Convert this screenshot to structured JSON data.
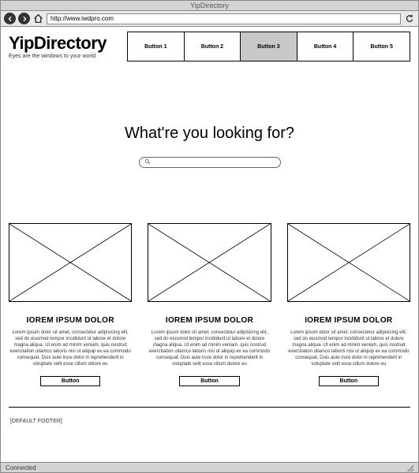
{
  "window": {
    "title": "YipDirectory",
    "status": "Connected"
  },
  "browser": {
    "url": "http://www.iwdpro.com"
  },
  "brand": {
    "name": "YipDirectory",
    "tagline": "Eyes are the windows to your world"
  },
  "nav": {
    "items": [
      {
        "label": "Button 1",
        "active": false
      },
      {
        "label": "Button 2",
        "active": false
      },
      {
        "label": "Button 3",
        "active": true
      },
      {
        "label": "Button 4",
        "active": false
      },
      {
        "label": "Button 5",
        "active": false
      }
    ]
  },
  "hero": {
    "heading": "What're you looking for?",
    "search_placeholder": ""
  },
  "cards": [
    {
      "title": "IOREM IPSUM DOLOR",
      "body": "Lorem ipsum dolor sit amet, consectetur adipisicing elit, sed do eiusmod tempor incididunt ut labore et dolore magna aliqua. Ut enim ad minim veniam, quis nostrud exercitation ullamco laboris nisi ut aliquip ex ea commodo consequat. Duis aute irure dolor in reprehenderit in voluptate velit esse cillum dolore eu",
      "button": "Button"
    },
    {
      "title": "IOREM IPSUM DOLOR",
      "body": "Lorem ipsum dolor sit amet, consectetur adipisicing elit, sed do eiusmod tempor incididunt ut labore et dolore magna aliqua. Ut enim ad minim veniam, quis nostrud exercitation ullamco laboris nisi ut aliquip ex ea commodo consequat. Duis aute irure dolor in reprehenderit in voluptate velit esse cillum dolore eu",
      "button": "Button"
    },
    {
      "title": "IOREM IPSUM DOLOR",
      "body": "Lorem ipsum dolor sit amet, consectetur adipisicing elit, sed do eiusmod tempor incididunt ut labore et dolore magna aliqua. Ut enim ad minim veniam, quis nostrud exercitation ullamco laboris nisi ut aliquip ex ea commodo consequat. Duis aute irure dolor in reprehenderit in voluptate velit esse cillum dolore eu",
      "button": "Button"
    }
  ],
  "footer": {
    "text": "[DEFAULT FOOTER]"
  }
}
